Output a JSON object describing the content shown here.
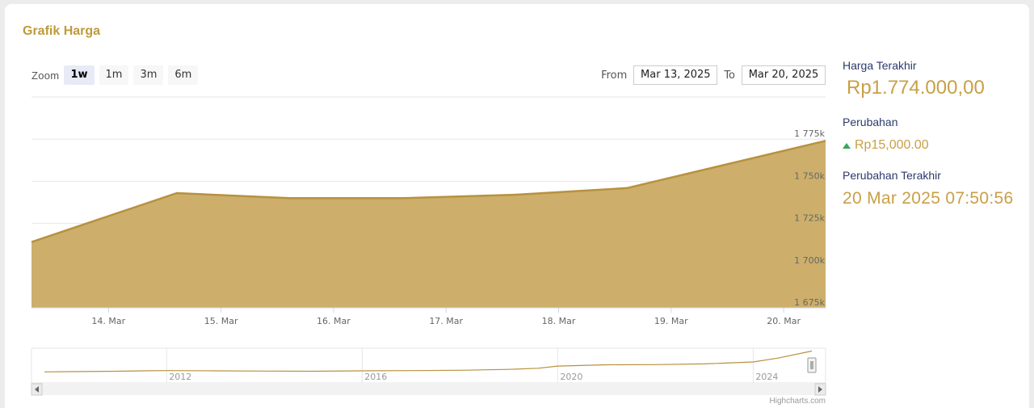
{
  "card_title": "Grafik Harga",
  "zoom": {
    "label": "Zoom",
    "buttons": [
      "1w",
      "1m",
      "3m",
      "6m"
    ],
    "active": "1w"
  },
  "range": {
    "from_label": "From",
    "from_value": "Mar 13, 2025",
    "to_label": "To",
    "to_value": "Mar 20, 2025"
  },
  "side_panel": {
    "last_price_label": "Harga Terakhir",
    "last_price_value": "Rp1.774.000,00",
    "change_label": "Perubahan",
    "change_value": "Rp15,000.00",
    "last_change_label": "Perubahan Terakhir",
    "last_change_value": "20 Mar 2025 07:50:56"
  },
  "credits": "Highcharts.com",
  "colors": {
    "fill": "#cdaf6b",
    "line": "#b8913f",
    "accent": "#c8a046",
    "up": "#3aa55d"
  },
  "chart_data": {
    "type": "area",
    "x": [
      "2025-03-13",
      "2025-03-14 07:00",
      "2025-03-15 07:00",
      "2025-03-16 07:00",
      "2025-03-17 07:00",
      "2025-03-18 07:00",
      "2025-03-20 07:50"
    ],
    "y": [
      1714000,
      1743000,
      1740000,
      1740000,
      1742000,
      1746000,
      1774000
    ],
    "x_tick_labels": [
      "14. Mar",
      "15. Mar",
      "16. Mar",
      "17. Mar",
      "18. Mar",
      "19. Mar",
      "20. Mar"
    ],
    "y_tick_labels": [
      "1 675k",
      "1 700k",
      "1 725k",
      "1 750k",
      "1 775k"
    ],
    "y_tick_values": [
      1675000,
      1700000,
      1725000,
      1750000,
      1775000
    ],
    "ylim": [
      1675000,
      1800000
    ],
    "grid": true,
    "navigator": {
      "x_labels": [
        "2012",
        "2016",
        "2020",
        "2024"
      ],
      "years": [
        2009.5,
        2010,
        2011,
        2011.5,
        2012,
        2013,
        2014,
        2015,
        2016,
        2017,
        2018,
        2019,
        2019.6,
        2020,
        2021,
        2022,
        2023,
        2024,
        2024.5,
        2025.2
      ],
      "values": [
        520000,
        535000,
        560000,
        585000,
        600000,
        585000,
        570000,
        560000,
        585000,
        600000,
        620000,
        670000,
        740000,
        870000,
        950000,
        960000,
        1000000,
        1120000,
        1350000,
        1774000
      ]
    }
  }
}
